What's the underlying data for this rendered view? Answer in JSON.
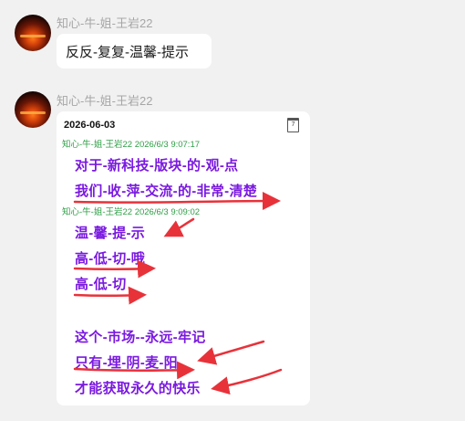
{
  "messages": [
    {
      "sender": "知心-牛-姐-王岩22",
      "text": "反反-复复-温馨-提示"
    },
    {
      "sender": "知心-牛-姐-王岩22",
      "card": {
        "date": "2026-06-03",
        "calendar_day": "7",
        "posts": [
          {
            "meta": "知心-牛-姐-王岩22 2026/6/3 9:07:17",
            "lines": [
              "对于-新科技-版块-的-观-点",
              "我们-收-萍-交流-的-非常-清楚"
            ]
          },
          {
            "meta": "知心-牛-姐-王岩22 2026/6/3 9:09:02",
            "lines": [
              "温-馨-提-示",
              "高-低-切-哦",
              "高-低-切",
              "",
              "这个-市场--永远-牢记",
              "只有-埋-阴-麦-阳",
              "才能获取永久的快乐"
            ]
          }
        ]
      }
    }
  ],
  "colors": {
    "accent_text": "#7a19e0",
    "meta_text": "#2e9e46",
    "arrow": "#e8323a"
  },
  "icons": [
    "avatar",
    "calendar-icon",
    "red-arrow"
  ]
}
